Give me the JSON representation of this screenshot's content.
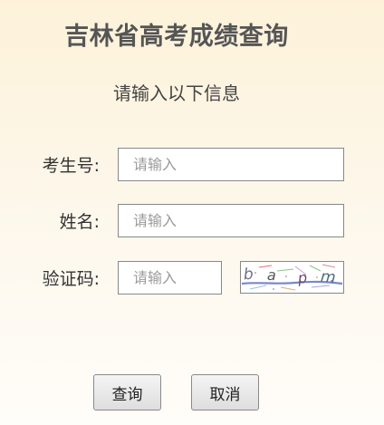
{
  "page": {
    "title": "吉林省高考成绩查询",
    "subtitle": "请输入以下信息"
  },
  "form": {
    "exam_number": {
      "label": "考生号:",
      "placeholder": "请输入",
      "value": ""
    },
    "name": {
      "label": "姓名:",
      "placeholder": "请输入",
      "value": ""
    },
    "captcha": {
      "label": "验证码:",
      "placeholder": "请输入",
      "value": "",
      "image_text": "bapm"
    }
  },
  "buttons": {
    "submit_label": "查询",
    "cancel_label": "取消"
  }
}
